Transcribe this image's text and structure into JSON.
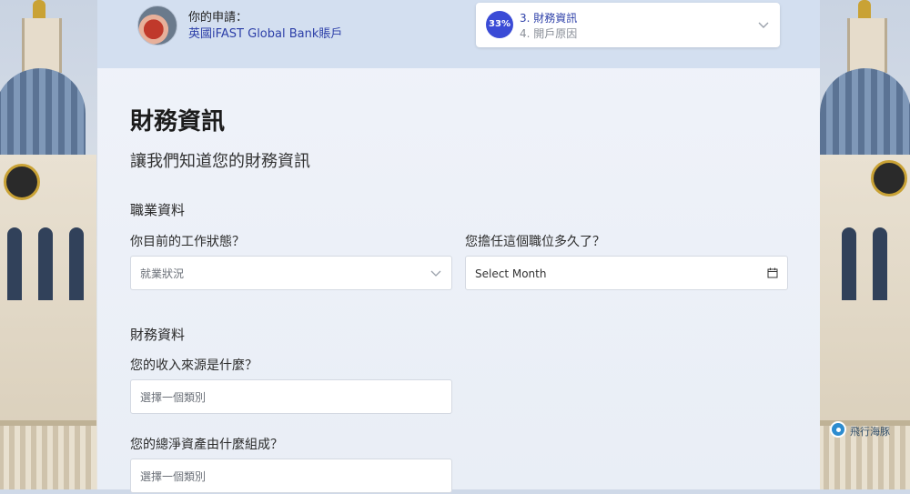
{
  "header": {
    "application_label": "你的申請：",
    "application_link": "英國iFAST Global Bank賬戶"
  },
  "stepper": {
    "percent": "33%",
    "current_step": "3. 財務資訊",
    "next_step": "4. 開戶原因",
    "chevron_icon": "chevron-down-icon"
  },
  "main": {
    "title": "財務資訊",
    "subtitle": "讓我們知道您的財務資訊",
    "employment_section": "職業資料",
    "employment_status_label": "你目前的工作狀態？",
    "employment_status_placeholder": "就業狀況",
    "duration_label": "您擔任這個職位多久了？",
    "duration_placeholder": "Select Month",
    "financial_section": "財務資料",
    "income_source_label": "您的收入來源是什麼？",
    "income_source_placeholder": "選擇一個類別",
    "net_assets_label": "您的總淨資產由什麼組成？",
    "net_assets_placeholder": "選擇一個類別"
  },
  "watermark": {
    "text": "飛行海豚"
  },
  "colors": {
    "accent": "#3a4bd6",
    "link": "#2c3fa8",
    "header_bg": "#d3dff0"
  }
}
